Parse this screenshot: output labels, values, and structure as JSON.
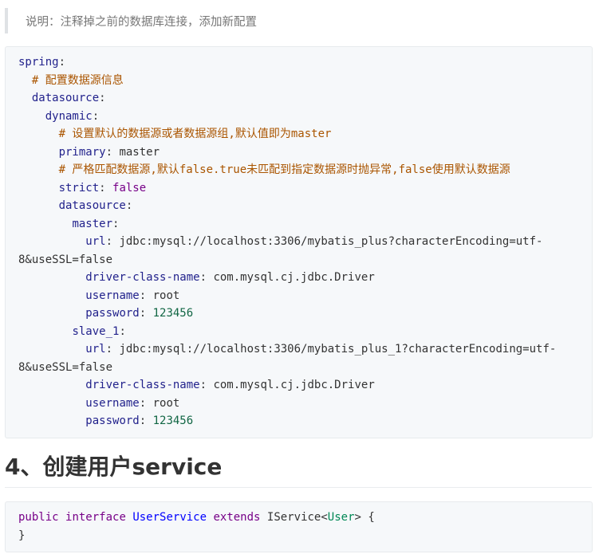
{
  "note": {
    "text": "说明：注释掉之前的数据库连接，添加新配置"
  },
  "yaml": {
    "spring": "spring",
    "comment1": "# 配置数据源信息",
    "datasource": "datasource",
    "dynamic": "dynamic",
    "comment2": "# 设置默认的数据源或者数据源组,默认值即为master",
    "primary_key": "primary",
    "primary_val": "master",
    "comment3": "# 严格匹配数据源,默认false.true未匹配到指定数据源时抛异常,false使用默认数据源",
    "strict_key": "strict",
    "strict_val": "false",
    "datasource2": "datasource",
    "master": "master",
    "m_url_key": "url",
    "m_url_val": "jdbc:mysql://localhost:3306/mybatis_plus?characterEncoding=utf-",
    "m_url_cont": "8&useSSL=false",
    "m_driver_key": "driver-class-name",
    "m_driver_val": "com.mysql.cj.jdbc.Driver",
    "m_user_key": "username",
    "m_user_val": "root",
    "m_pass_key": "password",
    "m_pass_val": "123456",
    "slave": "slave_1",
    "s_url_key": "url",
    "s_url_val": "jdbc:mysql://localhost:3306/mybatis_plus_1?characterEncoding=utf-",
    "s_url_cont": "8&useSSL=false",
    "s_driver_key": "driver-class-name",
    "s_driver_val": "com.mysql.cj.jdbc.Driver",
    "s_user_key": "username",
    "s_user_val": "root",
    "s_pass_key": "password",
    "s_pass_val": "123456"
  },
  "heading": "4、创建用户service",
  "java": {
    "public": "public",
    "interface": "interface",
    "name": "UserService",
    "extends": "extends",
    "iservice": "IService",
    "lt": "<",
    "user": "User",
    "gt": ">",
    "brace_open": " {",
    "brace_close": "}"
  }
}
